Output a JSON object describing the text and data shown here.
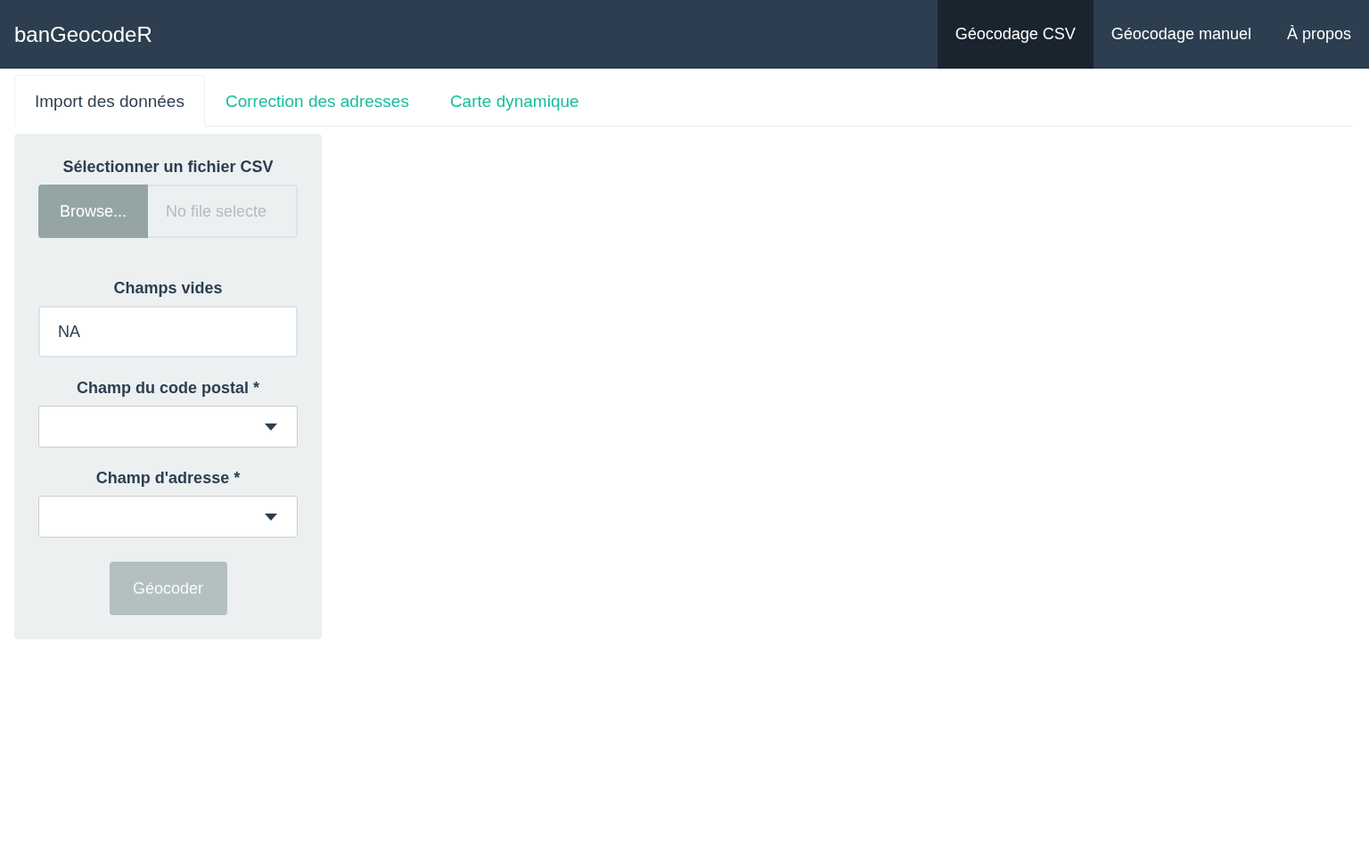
{
  "navbar": {
    "brand": "banGeocodeR",
    "items": [
      {
        "label": "Géocodage CSV",
        "selected": true
      },
      {
        "label": "Géocodage manuel",
        "selected": false
      },
      {
        "label": "À propos",
        "selected": false
      }
    ]
  },
  "tabs": [
    {
      "label": "Import des données",
      "selected": true
    },
    {
      "label": "Correction des adresses",
      "selected": false
    },
    {
      "label": "Carte dynamique",
      "selected": false
    }
  ],
  "sidebar": {
    "file_input": {
      "label": "Sélectionner un fichier CSV",
      "button": "Browse...",
      "placeholder": "No file selecte"
    },
    "fields": [
      {
        "kind": "text",
        "label": "Champs vides",
        "value": "NA"
      },
      {
        "kind": "select",
        "label": "Champ du code postal *"
      },
      {
        "kind": "select",
        "label": "Champ d'adresse *"
      }
    ],
    "submit": {
      "label": "Géocoder",
      "disabled": true
    }
  }
}
